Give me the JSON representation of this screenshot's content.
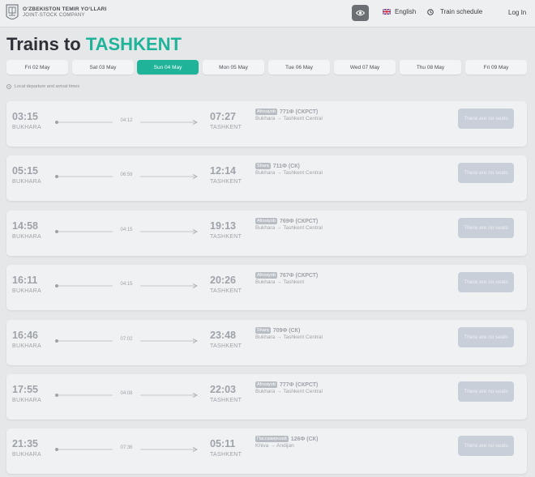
{
  "header": {
    "brand_title": "O‘ZBEKISTON TEMIR YO‘LLARI",
    "brand_subtitle": "JOINT-STOCK COMPANY",
    "language": "English",
    "schedule_label": "Train schedule",
    "login_label": "Log In"
  },
  "page": {
    "title_prefix": "Trains to",
    "title_city": "TASHKENT"
  },
  "dates": [
    {
      "label": "Fri 02 May",
      "active": false
    },
    {
      "label": "Sat 03 May",
      "active": false
    },
    {
      "label": "Sun 04 May",
      "active": true
    },
    {
      "label": "Mon 05 May",
      "active": false
    },
    {
      "label": "Tue 06 May",
      "active": false
    },
    {
      "label": "Wed 07 May",
      "active": false
    },
    {
      "label": "Thu 08 May",
      "active": false
    },
    {
      "label": "Fri 09 May",
      "active": false
    }
  ],
  "note": "Local departure and arrival times",
  "trains": [
    {
      "dep_time": "03:15",
      "dep_city": "BUKHARA",
      "duration": "04:12",
      "arr_time": "07:27",
      "arr_city": "TASHKENT",
      "type": "Afrosiyob",
      "number": "771Ф (СКРСТ)",
      "route": "Bukhara → Tashkent Central",
      "status": "There are no seats"
    },
    {
      "dep_time": "05:15",
      "dep_city": "BUKHARA",
      "duration": "06:59",
      "arr_time": "12:14",
      "arr_city": "TASHKENT",
      "type": "Sharq",
      "number": "711Ф (СК)",
      "route": "Bukhara → Tashkent Central",
      "status": "There are no seats"
    },
    {
      "dep_time": "14:58",
      "dep_city": "BUKHARA",
      "duration": "04:15",
      "arr_time": "19:13",
      "arr_city": "TASHKENT",
      "type": "Afrosiyob",
      "number": "769Ф (СКРСТ)",
      "route": "Bukhara → Tashkent Central",
      "status": "There are no seats"
    },
    {
      "dep_time": "16:11",
      "dep_city": "BUKHARA",
      "duration": "04:15",
      "arr_time": "20:26",
      "arr_city": "TASHKENT",
      "type": "Afrosiyob",
      "number": "767Ф (СКРСТ)",
      "route": "Bukhara → Tashkent",
      "status": "There are no seats"
    },
    {
      "dep_time": "16:46",
      "dep_city": "BUKHARA",
      "duration": "07:02",
      "arr_time": "23:48",
      "arr_city": "TASHKENT",
      "type": "Sharq",
      "number": "709Ф (СК)",
      "route": "Bukhara → Tashkent Central",
      "status": "There are no seats"
    },
    {
      "dep_time": "17:55",
      "dep_city": "BUKHARA",
      "duration": "04:08",
      "arr_time": "22:03",
      "arr_city": "TASHKENT",
      "type": "Afrosiyob",
      "number": "777Ф (СКРСТ)",
      "route": "Bukhara → Tashkent Central",
      "status": "There are no seats"
    },
    {
      "dep_time": "21:35",
      "dep_city": "BUKHARA",
      "duration": "07:36",
      "arr_time": "05:11",
      "arr_city": "TASHKENT",
      "type": "Пассажирский",
      "number": "126Ф (СК)",
      "route": "Khiva → Andijan",
      "status": "There are no seats"
    }
  ],
  "colors": {
    "accent": "#1fb49a",
    "background": "#e6e7e9",
    "card": "#f0f1f2",
    "disabled_button": "#c9cfd9",
    "muted_text": "#9ea3aa"
  },
  "icons": {
    "logo": "railway-emblem-icon",
    "accessibility": "eye-icon",
    "language": "uk-flag-icon",
    "schedule": "clock-icon",
    "note": "clock-icon"
  }
}
